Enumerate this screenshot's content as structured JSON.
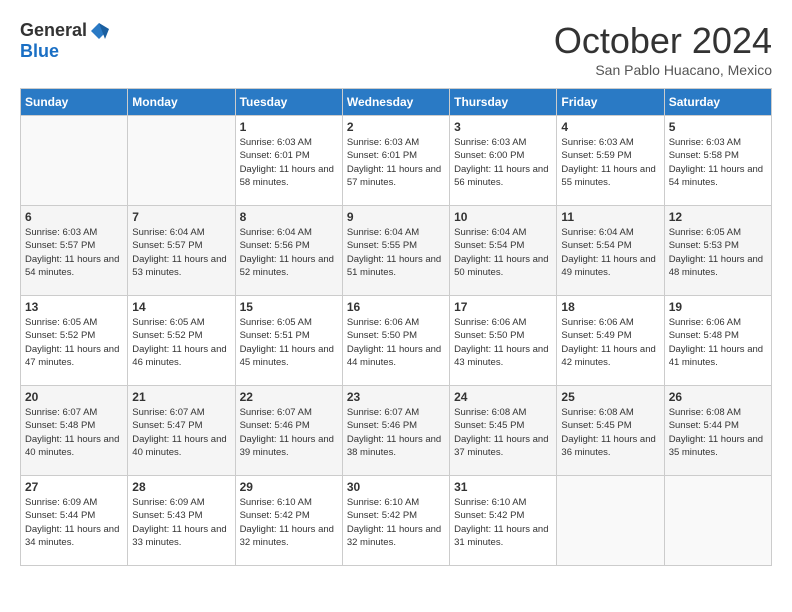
{
  "logo": {
    "general": "General",
    "blue": "Blue"
  },
  "title": "October 2024",
  "location": "San Pablo Huacano, Mexico",
  "days_of_week": [
    "Sunday",
    "Monday",
    "Tuesday",
    "Wednesday",
    "Thursday",
    "Friday",
    "Saturday"
  ],
  "weeks": [
    [
      {
        "day": "",
        "empty": true
      },
      {
        "day": "",
        "empty": true
      },
      {
        "day": "1",
        "sunrise": "6:03 AM",
        "sunset": "6:01 PM",
        "daylight": "11 hours and 58 minutes."
      },
      {
        "day": "2",
        "sunrise": "6:03 AM",
        "sunset": "6:01 PM",
        "daylight": "11 hours and 57 minutes."
      },
      {
        "day": "3",
        "sunrise": "6:03 AM",
        "sunset": "6:00 PM",
        "daylight": "11 hours and 56 minutes."
      },
      {
        "day": "4",
        "sunrise": "6:03 AM",
        "sunset": "5:59 PM",
        "daylight": "11 hours and 55 minutes."
      },
      {
        "day": "5",
        "sunrise": "6:03 AM",
        "sunset": "5:58 PM",
        "daylight": "11 hours and 54 minutes."
      }
    ],
    [
      {
        "day": "6",
        "sunrise": "6:03 AM",
        "sunset": "5:57 PM",
        "daylight": "11 hours and 54 minutes."
      },
      {
        "day": "7",
        "sunrise": "6:04 AM",
        "sunset": "5:57 PM",
        "daylight": "11 hours and 53 minutes."
      },
      {
        "day": "8",
        "sunrise": "6:04 AM",
        "sunset": "5:56 PM",
        "daylight": "11 hours and 52 minutes."
      },
      {
        "day": "9",
        "sunrise": "6:04 AM",
        "sunset": "5:55 PM",
        "daylight": "11 hours and 51 minutes."
      },
      {
        "day": "10",
        "sunrise": "6:04 AM",
        "sunset": "5:54 PM",
        "daylight": "11 hours and 50 minutes."
      },
      {
        "day": "11",
        "sunrise": "6:04 AM",
        "sunset": "5:54 PM",
        "daylight": "11 hours and 49 minutes."
      },
      {
        "day": "12",
        "sunrise": "6:05 AM",
        "sunset": "5:53 PM",
        "daylight": "11 hours and 48 minutes."
      }
    ],
    [
      {
        "day": "13",
        "sunrise": "6:05 AM",
        "sunset": "5:52 PM",
        "daylight": "11 hours and 47 minutes."
      },
      {
        "day": "14",
        "sunrise": "6:05 AM",
        "sunset": "5:52 PM",
        "daylight": "11 hours and 46 minutes."
      },
      {
        "day": "15",
        "sunrise": "6:05 AM",
        "sunset": "5:51 PM",
        "daylight": "11 hours and 45 minutes."
      },
      {
        "day": "16",
        "sunrise": "6:06 AM",
        "sunset": "5:50 PM",
        "daylight": "11 hours and 44 minutes."
      },
      {
        "day": "17",
        "sunrise": "6:06 AM",
        "sunset": "5:50 PM",
        "daylight": "11 hours and 43 minutes."
      },
      {
        "day": "18",
        "sunrise": "6:06 AM",
        "sunset": "5:49 PM",
        "daylight": "11 hours and 42 minutes."
      },
      {
        "day": "19",
        "sunrise": "6:06 AM",
        "sunset": "5:48 PM",
        "daylight": "11 hours and 41 minutes."
      }
    ],
    [
      {
        "day": "20",
        "sunrise": "6:07 AM",
        "sunset": "5:48 PM",
        "daylight": "11 hours and 40 minutes."
      },
      {
        "day": "21",
        "sunrise": "6:07 AM",
        "sunset": "5:47 PM",
        "daylight": "11 hours and 40 minutes."
      },
      {
        "day": "22",
        "sunrise": "6:07 AM",
        "sunset": "5:46 PM",
        "daylight": "11 hours and 39 minutes."
      },
      {
        "day": "23",
        "sunrise": "6:07 AM",
        "sunset": "5:46 PM",
        "daylight": "11 hours and 38 minutes."
      },
      {
        "day": "24",
        "sunrise": "6:08 AM",
        "sunset": "5:45 PM",
        "daylight": "11 hours and 37 minutes."
      },
      {
        "day": "25",
        "sunrise": "6:08 AM",
        "sunset": "5:45 PM",
        "daylight": "11 hours and 36 minutes."
      },
      {
        "day": "26",
        "sunrise": "6:08 AM",
        "sunset": "5:44 PM",
        "daylight": "11 hours and 35 minutes."
      }
    ],
    [
      {
        "day": "27",
        "sunrise": "6:09 AM",
        "sunset": "5:44 PM",
        "daylight": "11 hours and 34 minutes."
      },
      {
        "day": "28",
        "sunrise": "6:09 AM",
        "sunset": "5:43 PM",
        "daylight": "11 hours and 33 minutes."
      },
      {
        "day": "29",
        "sunrise": "6:10 AM",
        "sunset": "5:42 PM",
        "daylight": "11 hours and 32 minutes."
      },
      {
        "day": "30",
        "sunrise": "6:10 AM",
        "sunset": "5:42 PM",
        "daylight": "11 hours and 32 minutes."
      },
      {
        "day": "31",
        "sunrise": "6:10 AM",
        "sunset": "5:42 PM",
        "daylight": "11 hours and 31 minutes."
      },
      {
        "day": "",
        "empty": true
      },
      {
        "day": "",
        "empty": true
      }
    ]
  ],
  "labels": {
    "sunrise": "Sunrise:",
    "sunset": "Sunset:",
    "daylight": "Daylight:"
  }
}
